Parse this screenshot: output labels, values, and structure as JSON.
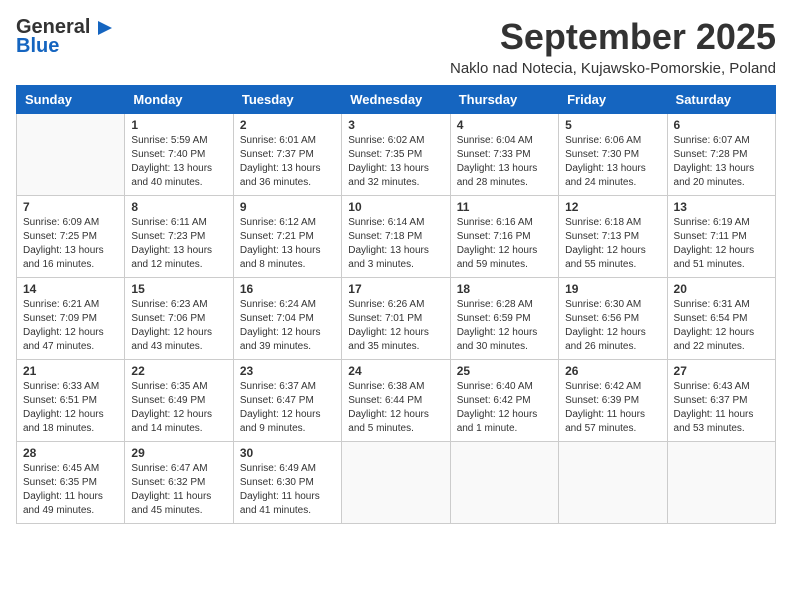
{
  "header": {
    "logo_general": "General",
    "logo_blue": "Blue",
    "month_title": "September 2025",
    "location": "Naklo nad Notecia, Kujawsko-Pomorskie, Poland"
  },
  "days_of_week": [
    "Sunday",
    "Monday",
    "Tuesday",
    "Wednesday",
    "Thursday",
    "Friday",
    "Saturday"
  ],
  "weeks": [
    [
      {
        "day": "",
        "info": ""
      },
      {
        "day": "1",
        "info": "Sunrise: 5:59 AM\nSunset: 7:40 PM\nDaylight: 13 hours\nand 40 minutes."
      },
      {
        "day": "2",
        "info": "Sunrise: 6:01 AM\nSunset: 7:37 PM\nDaylight: 13 hours\nand 36 minutes."
      },
      {
        "day": "3",
        "info": "Sunrise: 6:02 AM\nSunset: 7:35 PM\nDaylight: 13 hours\nand 32 minutes."
      },
      {
        "day": "4",
        "info": "Sunrise: 6:04 AM\nSunset: 7:33 PM\nDaylight: 13 hours\nand 28 minutes."
      },
      {
        "day": "5",
        "info": "Sunrise: 6:06 AM\nSunset: 7:30 PM\nDaylight: 13 hours\nand 24 minutes."
      },
      {
        "day": "6",
        "info": "Sunrise: 6:07 AM\nSunset: 7:28 PM\nDaylight: 13 hours\nand 20 minutes."
      }
    ],
    [
      {
        "day": "7",
        "info": "Sunrise: 6:09 AM\nSunset: 7:25 PM\nDaylight: 13 hours\nand 16 minutes."
      },
      {
        "day": "8",
        "info": "Sunrise: 6:11 AM\nSunset: 7:23 PM\nDaylight: 13 hours\nand 12 minutes."
      },
      {
        "day": "9",
        "info": "Sunrise: 6:12 AM\nSunset: 7:21 PM\nDaylight: 13 hours\nand 8 minutes."
      },
      {
        "day": "10",
        "info": "Sunrise: 6:14 AM\nSunset: 7:18 PM\nDaylight: 13 hours\nand 3 minutes."
      },
      {
        "day": "11",
        "info": "Sunrise: 6:16 AM\nSunset: 7:16 PM\nDaylight: 12 hours\nand 59 minutes."
      },
      {
        "day": "12",
        "info": "Sunrise: 6:18 AM\nSunset: 7:13 PM\nDaylight: 12 hours\nand 55 minutes."
      },
      {
        "day": "13",
        "info": "Sunrise: 6:19 AM\nSunset: 7:11 PM\nDaylight: 12 hours\nand 51 minutes."
      }
    ],
    [
      {
        "day": "14",
        "info": "Sunrise: 6:21 AM\nSunset: 7:09 PM\nDaylight: 12 hours\nand 47 minutes."
      },
      {
        "day": "15",
        "info": "Sunrise: 6:23 AM\nSunset: 7:06 PM\nDaylight: 12 hours\nand 43 minutes."
      },
      {
        "day": "16",
        "info": "Sunrise: 6:24 AM\nSunset: 7:04 PM\nDaylight: 12 hours\nand 39 minutes."
      },
      {
        "day": "17",
        "info": "Sunrise: 6:26 AM\nSunset: 7:01 PM\nDaylight: 12 hours\nand 35 minutes."
      },
      {
        "day": "18",
        "info": "Sunrise: 6:28 AM\nSunset: 6:59 PM\nDaylight: 12 hours\nand 30 minutes."
      },
      {
        "day": "19",
        "info": "Sunrise: 6:30 AM\nSunset: 6:56 PM\nDaylight: 12 hours\nand 26 minutes."
      },
      {
        "day": "20",
        "info": "Sunrise: 6:31 AM\nSunset: 6:54 PM\nDaylight: 12 hours\nand 22 minutes."
      }
    ],
    [
      {
        "day": "21",
        "info": "Sunrise: 6:33 AM\nSunset: 6:51 PM\nDaylight: 12 hours\nand 18 minutes."
      },
      {
        "day": "22",
        "info": "Sunrise: 6:35 AM\nSunset: 6:49 PM\nDaylight: 12 hours\nand 14 minutes."
      },
      {
        "day": "23",
        "info": "Sunrise: 6:37 AM\nSunset: 6:47 PM\nDaylight: 12 hours\nand 9 minutes."
      },
      {
        "day": "24",
        "info": "Sunrise: 6:38 AM\nSunset: 6:44 PM\nDaylight: 12 hours\nand 5 minutes."
      },
      {
        "day": "25",
        "info": "Sunrise: 6:40 AM\nSunset: 6:42 PM\nDaylight: 12 hours\nand 1 minute."
      },
      {
        "day": "26",
        "info": "Sunrise: 6:42 AM\nSunset: 6:39 PM\nDaylight: 11 hours\nand 57 minutes."
      },
      {
        "day": "27",
        "info": "Sunrise: 6:43 AM\nSunset: 6:37 PM\nDaylight: 11 hours\nand 53 minutes."
      }
    ],
    [
      {
        "day": "28",
        "info": "Sunrise: 6:45 AM\nSunset: 6:35 PM\nDaylight: 11 hours\nand 49 minutes."
      },
      {
        "day": "29",
        "info": "Sunrise: 6:47 AM\nSunset: 6:32 PM\nDaylight: 11 hours\nand 45 minutes."
      },
      {
        "day": "30",
        "info": "Sunrise: 6:49 AM\nSunset: 6:30 PM\nDaylight: 11 hours\nand 41 minutes."
      },
      {
        "day": "",
        "info": ""
      },
      {
        "day": "",
        "info": ""
      },
      {
        "day": "",
        "info": ""
      },
      {
        "day": "",
        "info": ""
      }
    ]
  ]
}
